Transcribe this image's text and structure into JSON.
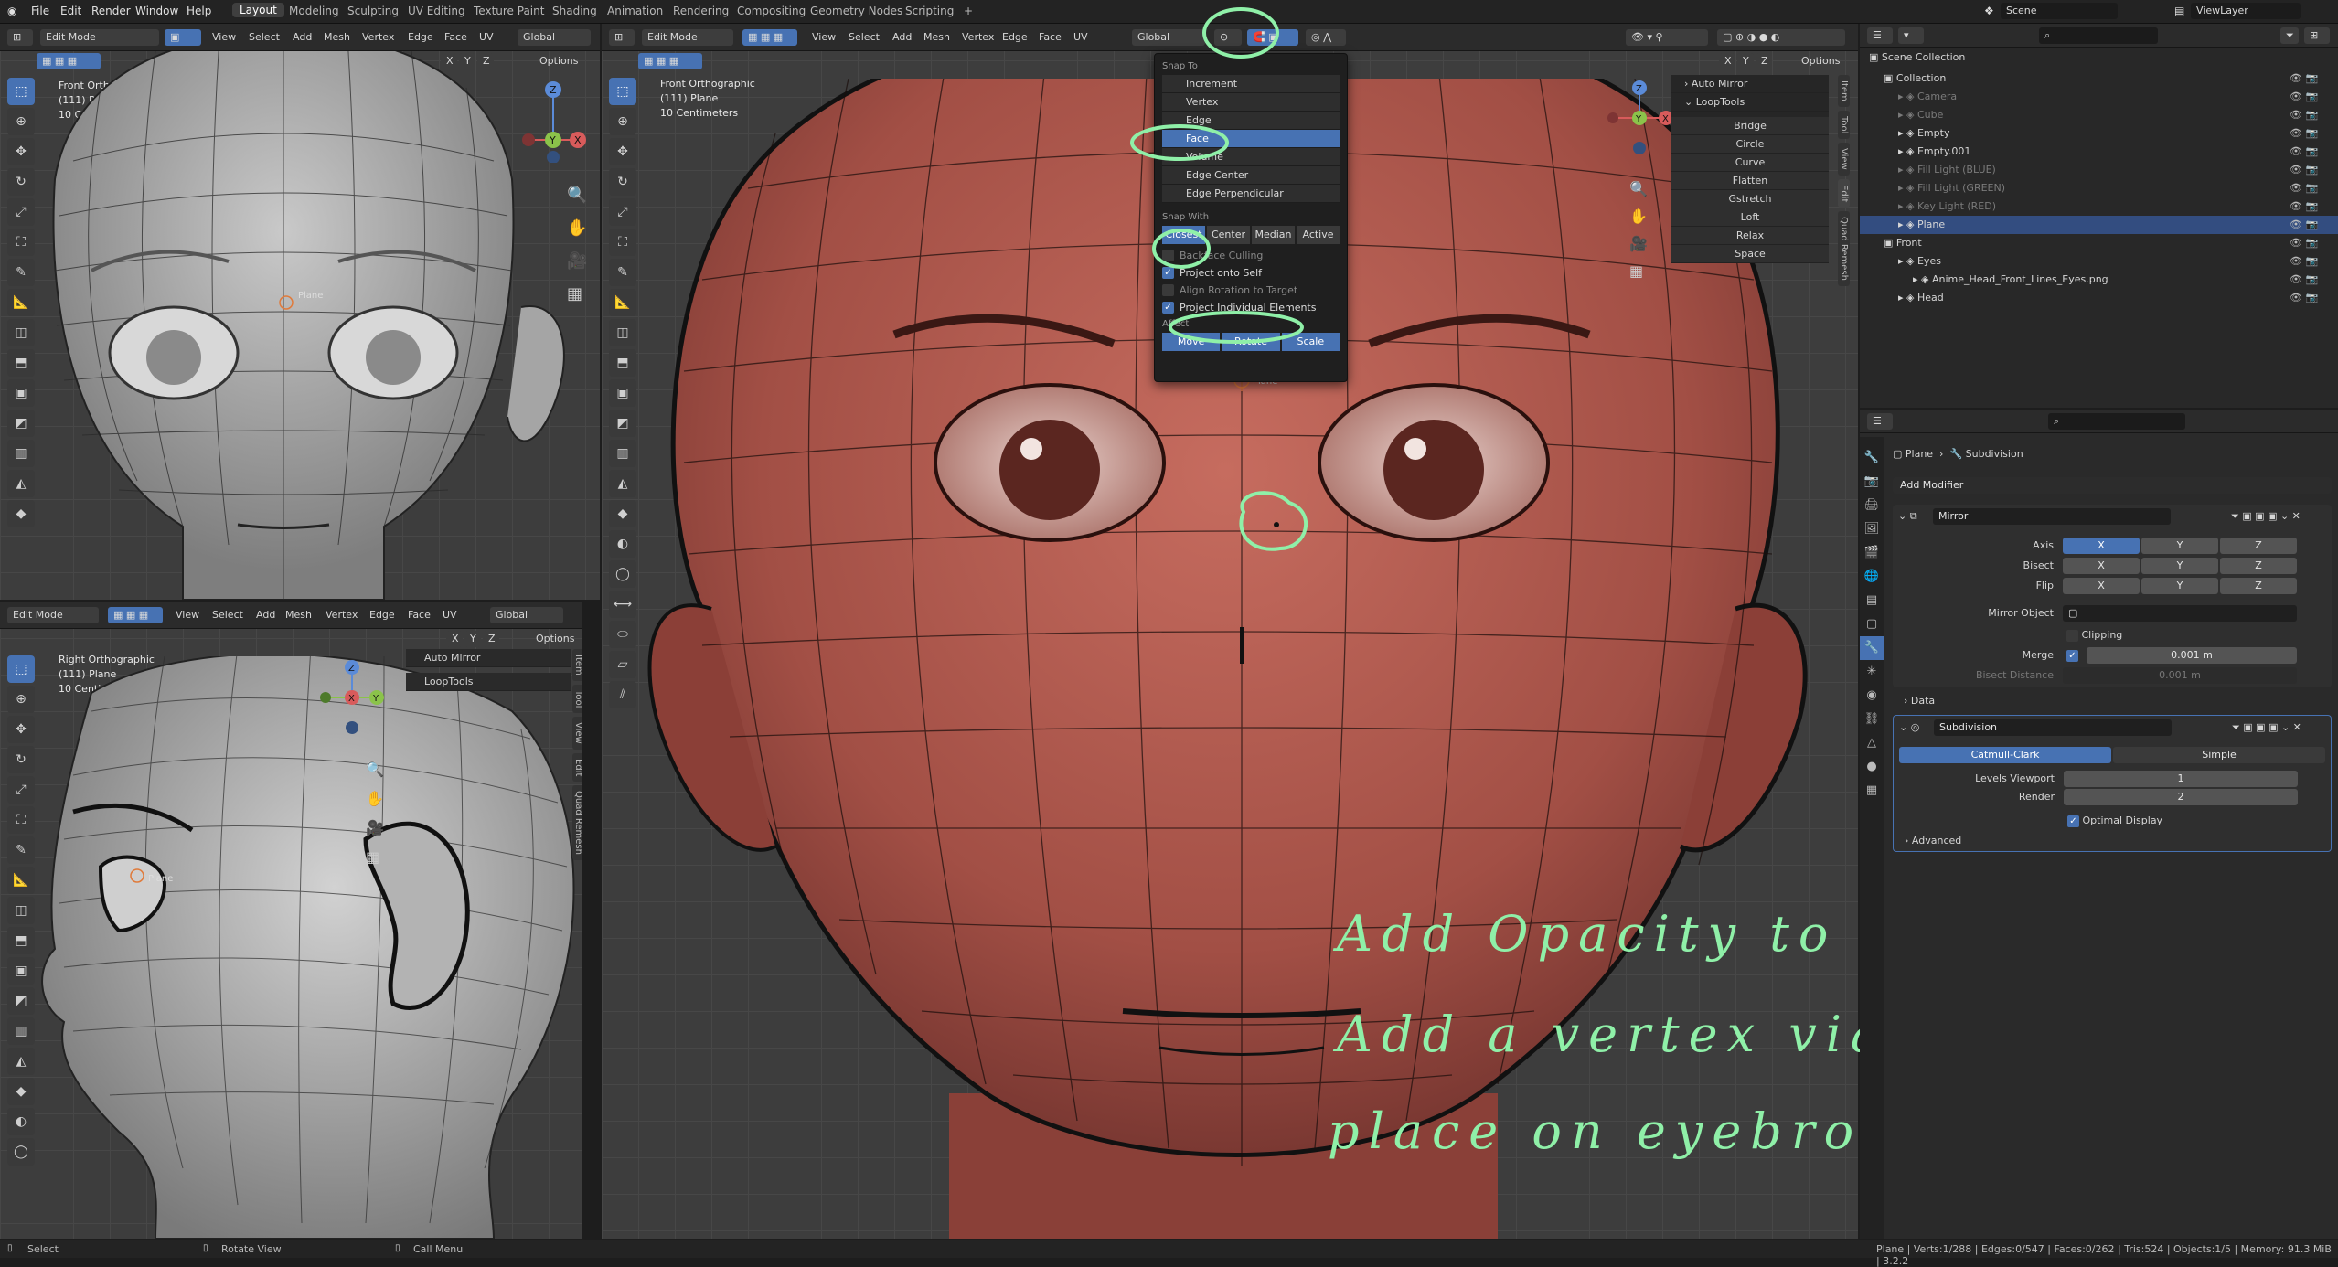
{
  "menu": [
    "File",
    "Edit",
    "Render",
    "Window",
    "Help"
  ],
  "workspaces": [
    "Layout",
    "Modeling",
    "Sculpting",
    "UV Editing",
    "Texture Paint",
    "Shading",
    "Animation",
    "Rendering",
    "Compositing",
    "Geometry Nodes",
    "Scripting",
    "+"
  ],
  "top_right": {
    "scene": "Scene",
    "view_layer": "ViewLayer"
  },
  "viewport_header": {
    "mode": "Edit Mode",
    "menus": [
      "View",
      "Select",
      "Add",
      "Mesh",
      "Vertex",
      "Edge",
      "Face",
      "UV"
    ],
    "orientation": "Global",
    "options": "Options",
    "axes": [
      "X",
      "Y",
      "Z"
    ]
  },
  "vp_top_left": {
    "view": "Front Orthographic",
    "object": "(111) Plane",
    "scale": "10 Centimeters",
    "origin_label": "Plane"
  },
  "vp_bottom_left": {
    "view": "Right Orthographic",
    "object": "(111) Plane",
    "scale": "10 Centimeters",
    "origin_label": "Plane",
    "panels": [
      "Auto Mirror",
      "LoopTools"
    ]
  },
  "vp_main": {
    "view": "Front Orthographic",
    "object": "(111) Plane",
    "scale": "10 Centimeters",
    "origin_label": "Plane"
  },
  "side_tabs": [
    "Item",
    "Tool",
    "View",
    "Edit",
    "Quad Remesh"
  ],
  "gizmo": {
    "x": "X",
    "y": "Y",
    "z": "Z"
  },
  "snap_menu": {
    "title": "Snap To",
    "items": [
      "Increment",
      "Vertex",
      "Edge",
      "Face",
      "Volume",
      "Edge Center",
      "Edge Perpendicular"
    ],
    "selected": "Face",
    "snap_with_label": "Snap With",
    "snap_with": [
      "Closest",
      "Center",
      "Median",
      "Active"
    ],
    "snap_with_selected": "Closest",
    "backface": "Backface Culling",
    "project_self": "Project onto Self",
    "align_rotation": "Align Rotation to Target",
    "project_individual": "Project Individual Elements",
    "affect_label": "Affect",
    "affect": [
      "Move",
      "Rotate",
      "Scale"
    ]
  },
  "n_panel": {
    "auto_mirror": "Auto Mirror",
    "looptools": "LoopTools",
    "buttons": [
      "Bridge",
      "Circle",
      "Curve",
      "Flatten",
      "Gstretch",
      "Loft",
      "Relax",
      "Space"
    ]
  },
  "outliner": {
    "root": "Scene Collection",
    "rows": [
      {
        "name": "Collection",
        "indent": 1,
        "dim": false,
        "sel": false
      },
      {
        "name": "Camera",
        "indent": 2,
        "dim": true,
        "sel": false
      },
      {
        "name": "Cube",
        "indent": 2,
        "dim": true,
        "sel": false
      },
      {
        "name": "Empty",
        "indent": 2,
        "dim": false,
        "sel": false
      },
      {
        "name": "Empty.001",
        "indent": 2,
        "dim": false,
        "sel": false
      },
      {
        "name": "Fill Light (BLUE)",
        "indent": 2,
        "dim": true,
        "sel": false
      },
      {
        "name": "Fill Light (GREEN)",
        "indent": 2,
        "dim": true,
        "sel": false
      },
      {
        "name": "Key Light (RED)",
        "indent": 2,
        "dim": true,
        "sel": false
      },
      {
        "name": "Plane",
        "indent": 2,
        "dim": false,
        "sel": true
      },
      {
        "name": "Front",
        "indent": 1,
        "dim": false,
        "sel": false
      },
      {
        "name": "Eyes",
        "indent": 2,
        "dim": false,
        "sel": false
      },
      {
        "name": "Anime_Head_Front_Lines_Eyes.png",
        "indent": 3,
        "dim": false,
        "sel": false
      },
      {
        "name": "Head",
        "indent": 2,
        "dim": false,
        "sel": false
      }
    ]
  },
  "properties": {
    "breadcrumb_object": "Plane",
    "breadcrumb_modifier": "Subdivision",
    "add_modifier": "Add Modifier",
    "mirror": {
      "name": "Mirror",
      "axis_label": "Axis",
      "bisect_label": "Bisect",
      "flip_label": "Flip",
      "xyz": [
        "X",
        "Y",
        "Z"
      ],
      "mirror_object_label": "Mirror Object",
      "clipping": "Clipping",
      "merge_label": "Merge",
      "merge_value": "0.001 m",
      "bisect_distance_label": "Bisect Distance",
      "bisect_distance_value": "0.001 m",
      "data": "Data"
    },
    "subdivision": {
      "name": "Subdivision",
      "catmull": "Catmull-Clark",
      "simple": "Simple",
      "levels_label": "Levels Viewport",
      "levels_value": "1",
      "render_label": "Render",
      "render_value": "2",
      "optimal": "Optimal Display",
      "advanced": "Advanced"
    }
  },
  "status": {
    "select": "Select",
    "rotate": "Rotate View",
    "call_menu": "Call Menu",
    "stats": "Plane | Verts:1/288 | Edges:0/547 | Faces:0/262 | Tris:524 | Objects:1/5 | Memory: 91.3 MiB | 3.2.2"
  },
  "handwriting": [
    "Add Opacity to eyes image",
    "Add a vertex via plane to center",
    "place on eyebrow."
  ],
  "colors": {
    "accent": "#4772b3",
    "annotation": "#8ff0a8",
    "skin": "#a9554a",
    "viewport_grid": "#3d3d3d"
  }
}
